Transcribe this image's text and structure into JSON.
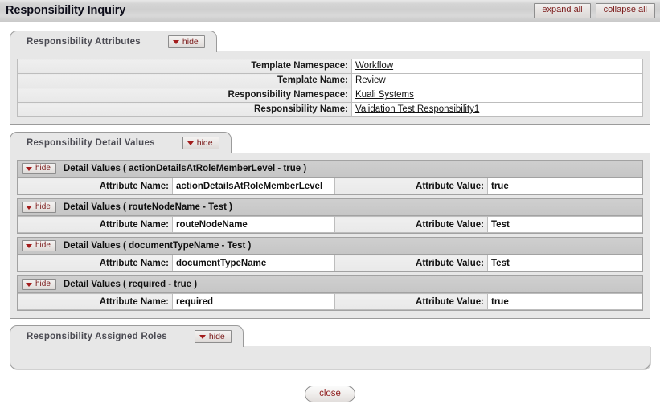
{
  "header": {
    "title": "Responsibility Inquiry",
    "expand_all_label": "expand all",
    "collapse_all_label": "collapse all"
  },
  "icons": {
    "caret_down": "caret-down-icon"
  },
  "panels": {
    "attributes": {
      "title": "Responsibility Attributes",
      "hide_label": "hide",
      "rows": [
        {
          "label": "Template Namespace:",
          "value": "Workflow "
        },
        {
          "label": "Template Name:",
          "value": "Review "
        },
        {
          "label": "Responsibility Namespace:",
          "value": "Kuali Systems "
        },
        {
          "label": "Responsibility Name:",
          "value": "Validation Test Responsibility1 "
        }
      ]
    },
    "detail_values": {
      "title": "Responsibility Detail Values",
      "hide_label": "hide",
      "blocks": [
        {
          "hide_label": "hide",
          "title": "Detail Values ( actionDetailsAtRoleMemberLevel - true )",
          "name_label": "Attribute Name:",
          "name_value": "actionDetailsAtRoleMemberLevel",
          "value_label": "Attribute Value:",
          "value_value": "true"
        },
        {
          "hide_label": "hide",
          "title": "Detail Values ( routeNodeName - Test )",
          "name_label": "Attribute Name:",
          "name_value": "routeNodeName",
          "value_label": "Attribute Value:",
          "value_value": "Test"
        },
        {
          "hide_label": "hide",
          "title": "Detail Values ( documentTypeName - Test )",
          "name_label": "Attribute Name:",
          "name_value": "documentTypeName",
          "value_label": "Attribute Value:",
          "value_value": "Test"
        },
        {
          "hide_label": "hide",
          "title": "Detail Values ( required - true )",
          "name_label": "Attribute Name:",
          "name_value": "required",
          "value_label": "Attribute Value:",
          "value_value": "true"
        }
      ]
    },
    "assigned_roles": {
      "title": "Responsibility Assigned Roles",
      "hide_label": "hide"
    }
  },
  "footer": {
    "close_label": "close"
  },
  "colors": {
    "accent_red": "#7b1a1a",
    "panel_bg": "#e7e7e7",
    "panel_border": "#9b9b9b"
  }
}
